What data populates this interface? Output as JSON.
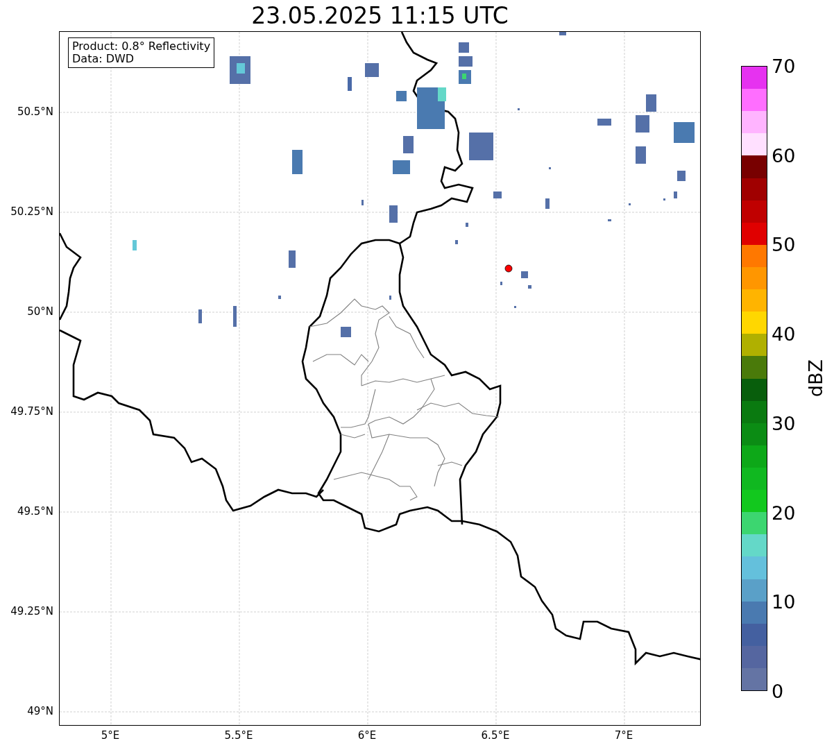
{
  "title": "23.05.2025 11:15 UTC",
  "info_box": [
    "Product: 0.8° Reflectivity",
    "Data: DWD"
  ],
  "x_ticks": [
    "5°E",
    "5.5°E",
    "6°E",
    "6.5°E",
    "7°E"
  ],
  "y_ticks": [
    "50.5°N",
    "50.25°N",
    "50°N",
    "49.75°N",
    "49.5°N",
    "49.25°N",
    "49°N"
  ],
  "colorbar": {
    "label": "dBZ",
    "ticks": [
      "70",
      "60",
      "50",
      "40",
      "30",
      "20",
      "10",
      "0"
    ],
    "segments": [
      {
        "color": "#e632f0"
      },
      {
        "color": "#ff6eff"
      },
      {
        "color": "#ffb4ff"
      },
      {
        "color": "#ffe0ff"
      },
      {
        "color": "#780000"
      },
      {
        "color": "#a00000"
      },
      {
        "color": "#c00000"
      },
      {
        "color": "#e00000"
      },
      {
        "color": "#ff7800"
      },
      {
        "color": "#ff9600"
      },
      {
        "color": "#ffb400"
      },
      {
        "color": "#ffd700"
      },
      {
        "color": "#b0b000"
      },
      {
        "color": "#4a7a0a"
      },
      {
        "color": "#085e0c"
      },
      {
        "color": "#0a7a10"
      },
      {
        "color": "#0b8c14"
      },
      {
        "color": "#0da818"
      },
      {
        "color": "#10b820"
      },
      {
        "color": "#12c81e"
      },
      {
        "color": "#3cd670"
      },
      {
        "color": "#64d8c8"
      },
      {
        "color": "#64c0dc"
      },
      {
        "color": "#5aa0c8"
      },
      {
        "color": "#4a7ab0"
      },
      {
        "color": "#4460a0"
      },
      {
        "color": "#5566a0"
      },
      {
        "color": "#6474a4"
      }
    ]
  }
}
